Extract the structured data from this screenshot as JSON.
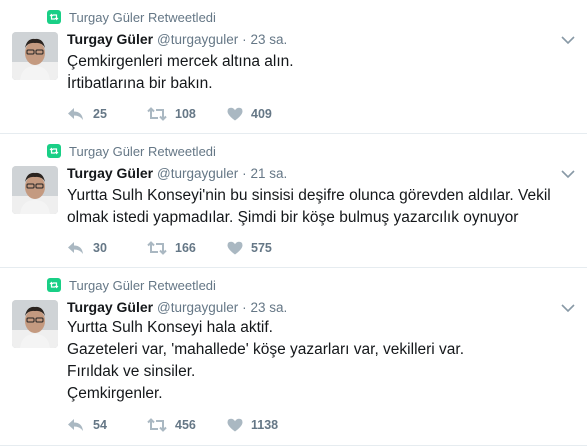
{
  "tweets": [
    {
      "retweet_context": "Turgay Güler Retweetledi",
      "author_name": "Turgay Güler",
      "handle": "@turgayguler",
      "separator": "·",
      "time": "23 sa.",
      "lines": [
        "Çemkirgenleri mercek altına alın.",
        "İrtibatlarına bir bakın."
      ],
      "replies": "25",
      "retweets": "108",
      "likes": "409"
    },
    {
      "retweet_context": "Turgay Güler Retweetledi",
      "author_name": "Turgay Güler",
      "handle": "@turgayguler",
      "separator": "·",
      "time": "21 sa.",
      "lines": [
        "Yurtta Sulh Konseyi'nin bu sinsisi deşifre olunca görevden aldılar. Vekil",
        "olmak istedi yapmadılar. Şimdi bir köşe bulmuş yazarcılık oynuyor"
      ],
      "replies": "30",
      "retweets": "166",
      "likes": "575"
    },
    {
      "retweet_context": "Turgay Güler Retweetledi",
      "author_name": "Turgay Güler",
      "handle": "@turgayguler",
      "separator": "·",
      "time": "23 sa.",
      "lines": [
        "Yurtta Sulh Konseyi hala aktif.",
        "Gazeteleri var, 'mahallede' köşe yazarları var, vekilleri var.",
        "Fırıldak ve sinsiler.",
        "Çemkirgenler."
      ],
      "replies": "54",
      "retweets": "456",
      "likes": "1138"
    }
  ],
  "icons": {
    "retweet_badge": "retweet-icon",
    "reply": "reply-icon",
    "retweet": "retweet-icon",
    "like": "heart-icon",
    "more": "chevron-down-icon"
  },
  "colors": {
    "retweet_green": "#19cf86",
    "secondary_text": "#657786",
    "action_icon": "#aab8c2",
    "divider": "#e6ecf0"
  }
}
